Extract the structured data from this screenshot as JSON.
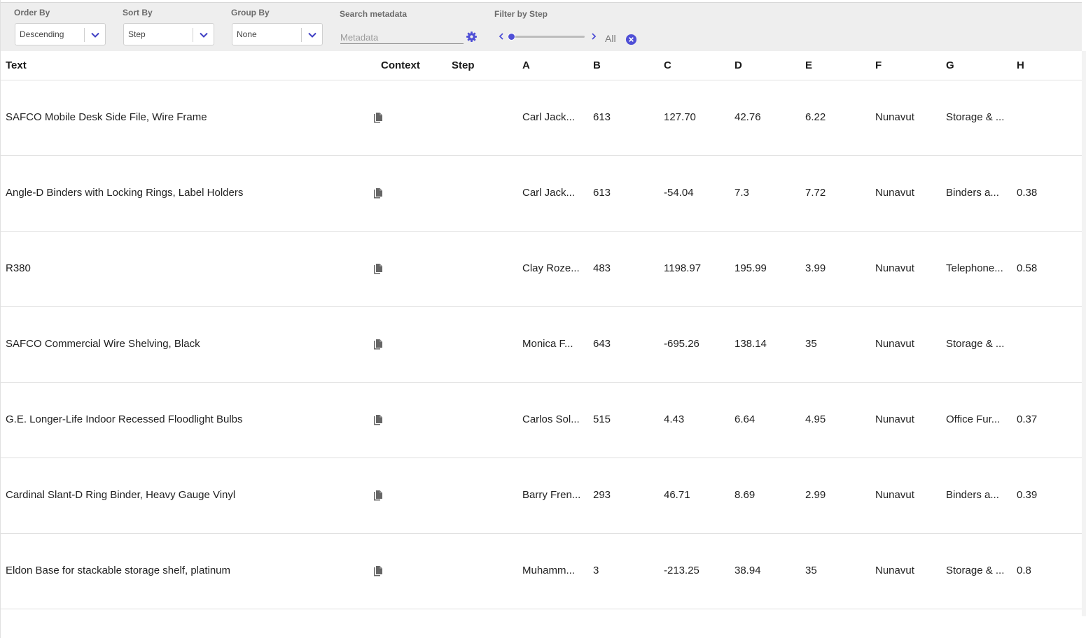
{
  "toolbar": {
    "order_by": {
      "label": "Order By",
      "value": "Descending"
    },
    "sort_by": {
      "label": "Sort By",
      "value": "Step"
    },
    "group_by": {
      "label": "Group By",
      "value": "None"
    },
    "search": {
      "label": "Search metadata",
      "placeholder": "Metadata"
    },
    "filter": {
      "label": "Filter by Step",
      "all_label": "All",
      "level": 0
    }
  },
  "colors": {
    "accent": "#4f4fd6",
    "toolbar_bg": "#eeeeee",
    "icon_gray": "#666666"
  },
  "icons": {
    "select": "chevron-down-icon",
    "search_settings": "gear-icon",
    "slider_prev": "chevron-left-icon",
    "slider_next": "chevron-right-icon",
    "clear": "close-circle-icon",
    "context": "copy-icon"
  },
  "table": {
    "headers": {
      "text": "Text",
      "context": "Context",
      "step": "Step",
      "a": "A",
      "b": "B",
      "c": "C",
      "d": "D",
      "e": "E",
      "f": "F",
      "g": "G",
      "h": "H"
    },
    "rows": [
      {
        "text": "SAFCO Mobile Desk Side File, Wire Frame",
        "step": "",
        "a": "Carl Jack...",
        "b": "613",
        "c": "127.70",
        "d": "42.76",
        "e": "6.22",
        "f": "Nunavut",
        "g": "Storage & ...",
        "h": ""
      },
      {
        "text": "Angle-D Binders with Locking Rings, Label Holders",
        "step": "",
        "a": "Carl Jack...",
        "b": "613",
        "c": "-54.04",
        "d": "7.3",
        "e": "7.72",
        "f": "Nunavut",
        "g": "Binders a...",
        "h": "0.38"
      },
      {
        "text": "R380",
        "step": "",
        "a": "Clay Roze...",
        "b": "483",
        "c": "1198.97",
        "d": "195.99",
        "e": "3.99",
        "f": "Nunavut",
        "g": "Telephone...",
        "h": "0.58"
      },
      {
        "text": "SAFCO Commercial Wire Shelving, Black",
        "step": "",
        "a": "Monica F...",
        "b": "643",
        "c": "-695.26",
        "d": "138.14",
        "e": "35",
        "f": "Nunavut",
        "g": "Storage & ...",
        "h": ""
      },
      {
        "text": "G.E. Longer-Life Indoor Recessed Floodlight Bulbs",
        "step": "",
        "a": "Carlos Sol...",
        "b": "515",
        "c": "4.43",
        "d": "6.64",
        "e": "4.95",
        "f": "Nunavut",
        "g": "Office Fur...",
        "h": "0.37"
      },
      {
        "text": "Cardinal Slant-D Ring Binder, Heavy Gauge Vinyl",
        "step": "",
        "a": "Barry Fren...",
        "b": "293",
        "c": "46.71",
        "d": "8.69",
        "e": "2.99",
        "f": "Nunavut",
        "g": "Binders a...",
        "h": "0.39"
      },
      {
        "text": "Eldon Base for stackable storage shelf, platinum",
        "step": "",
        "a": "Muhamm...",
        "b": "3",
        "c": "-213.25",
        "d": "38.94",
        "e": "35",
        "f": "Nunavut",
        "g": "Storage & ...",
        "h": "0.8"
      }
    ]
  }
}
